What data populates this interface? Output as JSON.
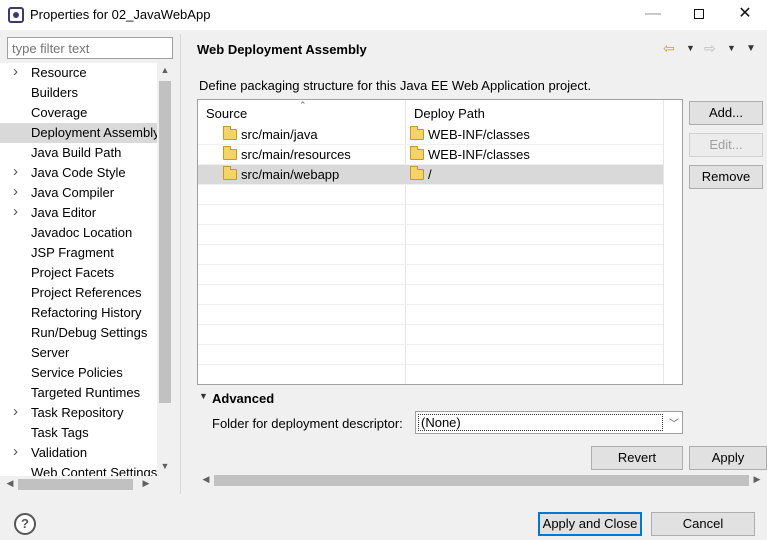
{
  "window": {
    "title": "Properties for 02_JavaWebApp",
    "min": "—",
    "close": "✕"
  },
  "filter": {
    "placeholder": "type filter text"
  },
  "tree": [
    {
      "label": "Resource",
      "expandable": true
    },
    {
      "label": "Builders",
      "expandable": false
    },
    {
      "label": "Coverage",
      "expandable": false
    },
    {
      "label": "Deployment Assembly",
      "expandable": false,
      "selected": true
    },
    {
      "label": "Java Build Path",
      "expandable": false
    },
    {
      "label": "Java Code Style",
      "expandable": true
    },
    {
      "label": "Java Compiler",
      "expandable": true
    },
    {
      "label": "Java Editor",
      "expandable": true
    },
    {
      "label": "Javadoc Location",
      "expandable": false
    },
    {
      "label": "JSP Fragment",
      "expandable": false
    },
    {
      "label": "Project Facets",
      "expandable": false
    },
    {
      "label": "Project References",
      "expandable": false
    },
    {
      "label": "Refactoring History",
      "expandable": false
    },
    {
      "label": "Run/Debug Settings",
      "expandable": false
    },
    {
      "label": "Server",
      "expandable": false
    },
    {
      "label": "Service Policies",
      "expandable": false
    },
    {
      "label": "Targeted Runtimes",
      "expandable": false
    },
    {
      "label": "Task Repository",
      "expandable": true
    },
    {
      "label": "Task Tags",
      "expandable": false
    },
    {
      "label": "Validation",
      "expandable": true
    },
    {
      "label": "Web Content Settings",
      "expandable": false
    }
  ],
  "page": {
    "title": "Web Deployment Assembly",
    "description": "Define packaging structure for this Java EE Web Application project."
  },
  "table": {
    "headers": {
      "source": "Source",
      "deploy": "Deploy Path"
    },
    "rows": [
      {
        "source": "src/main/java",
        "deploy": "WEB-INF/classes"
      },
      {
        "source": "src/main/resources",
        "deploy": "WEB-INF/classes"
      },
      {
        "source": "src/main/webapp",
        "deploy": "/"
      }
    ]
  },
  "buttons": {
    "add": "Add...",
    "edit": "Edit...",
    "remove": "Remove",
    "revert": "Revert",
    "apply": "Apply",
    "apply_close": "Apply and Close",
    "cancel": "Cancel"
  },
  "advanced": {
    "label": "Advanced",
    "descriptor_label": "Folder for deployment descriptor:",
    "descriptor_value": "(None)"
  },
  "icons": {
    "back": "back-arrow-icon",
    "forward": "forward-arrow-icon",
    "menu": "view-menu-icon",
    "help": "help-icon"
  },
  "colors": {
    "selection": "#d9d9d9",
    "focus_border": "#0078d7",
    "folder": "#f5d36b"
  }
}
